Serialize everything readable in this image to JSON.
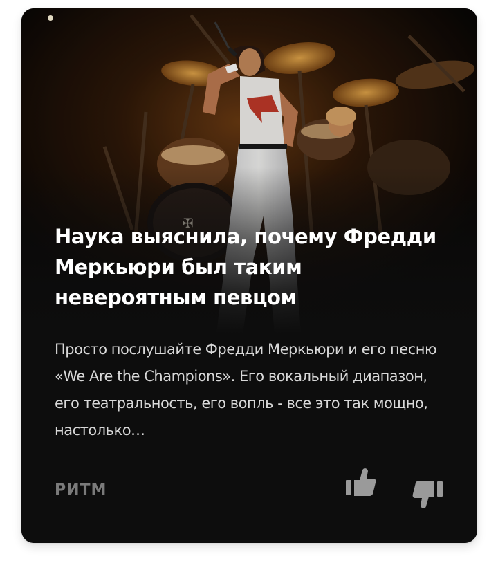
{
  "card": {
    "title": "Наука выяснила, почему Фредди Меркьюри был таким невероятным певцом",
    "snippet": "Просто послушайте Фредди Меркьюри и его песню «We Are the Champions». Его вокальный диапазон, его театральность, его вопль - все это так мощно, настолько…",
    "source": "РИТМ",
    "image_icon": "concert-photo",
    "like_icon": "thumbs-up-icon",
    "dislike_icon": "thumbs-down-icon"
  },
  "colors": {
    "card_background": "#0d0d0d",
    "title": "#ffffff",
    "snippet": "#d8d8d8",
    "source": "#7a7a7a",
    "icons": "#9a9a9a"
  }
}
